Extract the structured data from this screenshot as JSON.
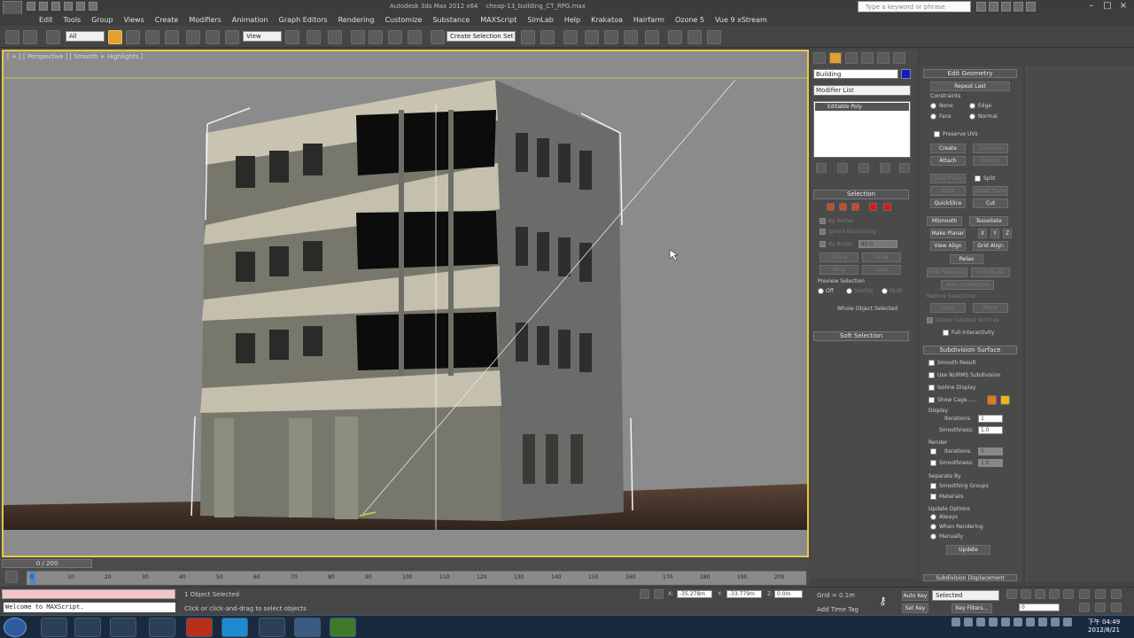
{
  "app": {
    "title": "Autodesk 3ds Max 2012 x64",
    "doc_title": "cheap-13_building_CT_RPG.max",
    "search_placeholder": "Type a keyword or phrase"
  },
  "menu": [
    "Edit",
    "Tools",
    "Group",
    "Views",
    "Create",
    "Modifiers",
    "Animation",
    "Graph Editors",
    "Rendering",
    "Customize",
    "Substance",
    "MAXScript",
    "SimLab",
    "Help",
    "Krakatoa",
    "Hairfarm",
    "Ozone 5",
    "Vue 9 xStream"
  ],
  "toolbar": {
    "selection_filter": "All",
    "ref_coord": "View",
    "named_selection_set": "Create Selection Set"
  },
  "viewport": {
    "label": "[ + ] [ Perspective ] [ Smooth + Highlights ]"
  },
  "command_panel": {
    "object_name": "Building",
    "object_color": "#1616d6",
    "modifier_list": "Modifier List",
    "stack_item": "Editable Poly",
    "selection_title": "Selection",
    "by_vertex": "By Vertex",
    "ignore_backfacing": "Ignore Backfacing",
    "by_angle": "By Angle:",
    "by_angle_value": "45.0",
    "shrink": "Shrink",
    "grow": "Grow",
    "ring": "Ring",
    "loop": "Loop",
    "preview_selection": "Preview Selection",
    "preview_off": "Off",
    "preview_subobj": "SubObj",
    "preview_multi": "Multi",
    "whole_object": "Whole Object Selected",
    "soft_selection": "Soft Selection"
  },
  "edit_geometry": {
    "title": "Edit Geometry",
    "repeat_last": "Repeat Last",
    "constraints": "Constraints",
    "none": "None",
    "edge": "Edge",
    "face": "Face",
    "normal": "Normal",
    "preserve_uvs": "Preserve UVs",
    "create": "Create",
    "collapse": "Collapse",
    "attach": "Attach",
    "detach": "Detach",
    "slice_plane": "Slice Plane",
    "split": "Split",
    "slice": "Slice",
    "reset_plane": "Reset Plane",
    "quickslice": "QuickSlice",
    "cut": "Cut",
    "msmooth": "MSmooth",
    "tessellate": "Tessellate",
    "make_planar": "Make Planar",
    "x": "X",
    "y": "Y",
    "z": "Z",
    "view_align": "View Align",
    "grid_align": "Grid Align",
    "relax": "Relax",
    "hide_selected": "Hide Selected",
    "unhide_all": "Unhide All",
    "hide_unselected": "Hide Unselected",
    "named_selections": "Named Selections:",
    "copy": "Copy",
    "paste": "Paste",
    "delete_isolated": "Delete Isolated Vertices",
    "full_interactivity": "Full Interactivity"
  },
  "subdivision": {
    "title": "Subdivision Surface",
    "smooth_result": "Smooth Result",
    "use_nurms": "Use NURMS Subdivision",
    "isoline": "Isoline Display",
    "show_cage": "Show Cage......",
    "display": "Display",
    "iterations": "Iterations:",
    "iterations_value": "1",
    "smoothness": "Smoothness:",
    "smoothness_value": "1.0",
    "render": "Render",
    "r_iterations_value": "0",
    "r_smoothness_value": "1.0",
    "separate_by": "Separate By",
    "smoothing_groups": "Smoothing Groups",
    "materials": "Materials",
    "update_options": "Update Options",
    "always": "Always",
    "when_rendering": "When Rendering",
    "manually": "Manually",
    "update": "Update",
    "subdiv_displacement": "Subdivision Displacement",
    "cage_color_1": "#e07a1a",
    "cage_color_2": "#f0b020"
  },
  "timeline": {
    "slider_label": "0 / 200",
    "ticks": [
      "0",
      "10",
      "20",
      "30",
      "40",
      "50",
      "60",
      "70",
      "80",
      "90",
      "100",
      "110",
      "120",
      "130",
      "140",
      "150",
      "160",
      "170",
      "180",
      "190",
      "200"
    ]
  },
  "status": {
    "maxscript_prompt": "Welcome to MAXScript.",
    "objects_selected": "1 Object Selected",
    "hint": "Click or click-and-drag to select objects",
    "x_label": "X:",
    "x_value": "-35.278m",
    "y_label": "Y:",
    "y_value": "-33.779m",
    "z_label": "Z:",
    "z_value": "0.0m",
    "grid": "Grid = 0.1m",
    "add_time_tag": "Add Time Tag",
    "auto_key": "Auto Key",
    "set_key": "Set Key",
    "key_mode": "Selected",
    "key_filters": "Key Filters...",
    "frame": "0"
  },
  "taskbar": {
    "time": "下午 04:49",
    "date": "2012/8/21"
  }
}
